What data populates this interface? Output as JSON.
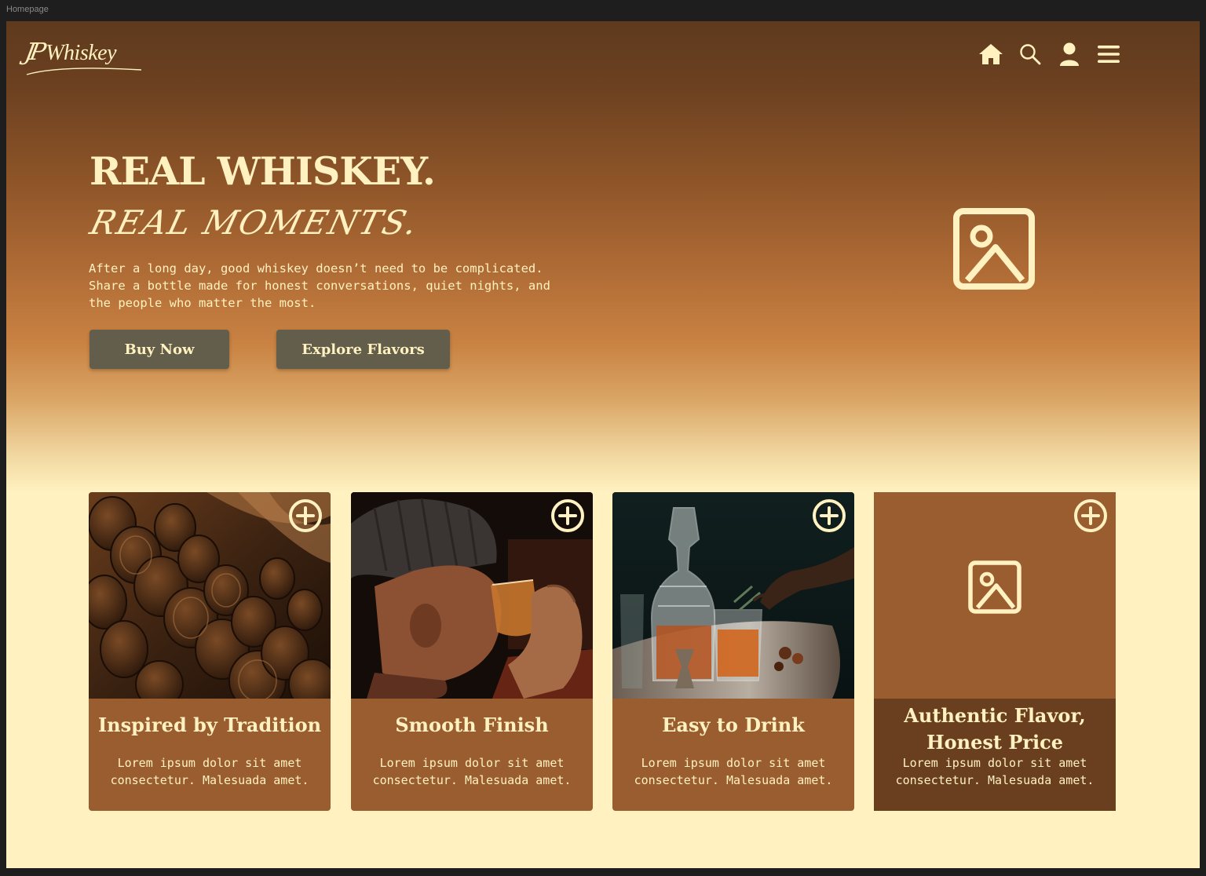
{
  "frame": {
    "label": "Homepage"
  },
  "header": {
    "logo_monogram": "JP",
    "logo_word": "Whiskey",
    "icons": [
      "home-icon",
      "search-icon",
      "user-icon",
      "menu-icon"
    ]
  },
  "hero": {
    "title": "REAL WHISKEY.",
    "subtitle": "REAL MOMENTS.",
    "description": "After a long day, good whiskey doesn’t need to be complicated. Share a bottle made for honest conversations, quiet nights, and the people who matter the most.",
    "buy_label": "Buy Now",
    "explore_label": "Explore Flavors",
    "image_icon": "image-placeholder-icon"
  },
  "cards": [
    {
      "title": "Inspired by Tradition",
      "text": "Lorem ipsum dolor sit amet consectetur. Malesuada amet.",
      "image": "whiskey barrels in cellar"
    },
    {
      "title": "Smooth Finish",
      "text": "Lorem ipsum dolor sit amet consectetur. Malesuada amet.",
      "image": "man in beanie drinking whiskey"
    },
    {
      "title": "Easy to Drink",
      "text": "Lorem ipsum dolor sit amet consectetur. Malesuada amet.",
      "image": "crystal decanter and cocktail glass"
    },
    {
      "title": "Authentic Flavor, Honest Price",
      "text": "Lorem ipsum dolor sit amet consectetur. Malesuada amet.",
      "image": "image placeholder"
    }
  ],
  "colors": {
    "cream": "#fff2c0",
    "brown_dark": "#5f3a1e",
    "amber": "#c98242",
    "card_brown": "#9a5d30",
    "button_olive": "#635e4b"
  }
}
